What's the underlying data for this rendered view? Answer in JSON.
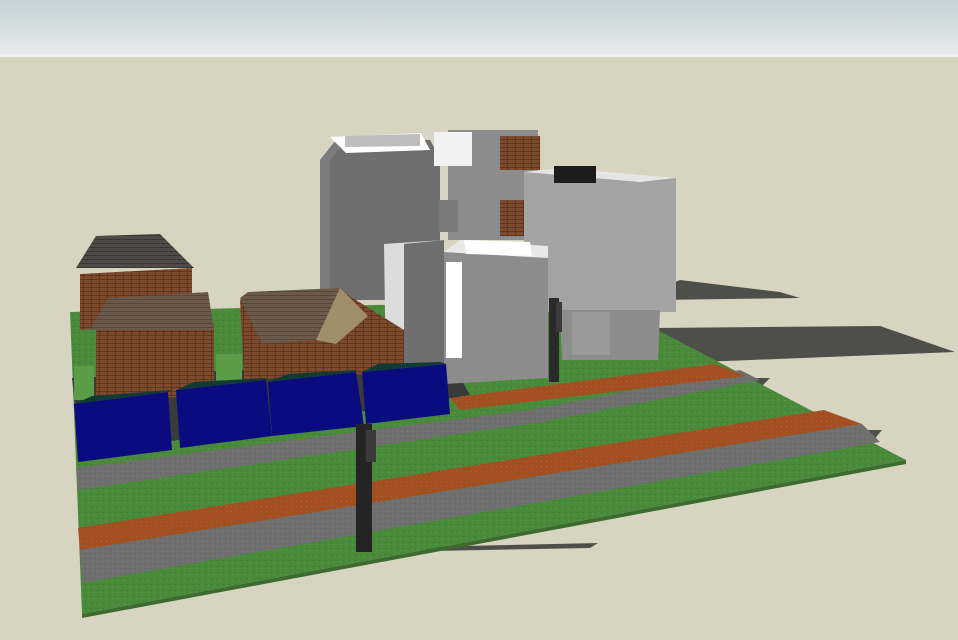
{
  "viewport": {
    "sky_color": "#d2dde1",
    "ground_color": "#d8d4c2",
    "grass_color": "#4d8a3a",
    "road_color": "#6e6e6e",
    "path_color": "#a04f24",
    "building_gray": "#8a8a8a",
    "roof_brown": "#5a4634",
    "brick_color": "#7a4a30",
    "container_blue": "#0d0d7a",
    "shadow_color": "#4a4a44"
  },
  "scene": {
    "objects": [
      "terrain-slab",
      "road-near",
      "bike-path-near",
      "road-far",
      "bike-path-far",
      "tower-block-left",
      "tower-block-back",
      "office-block-right",
      "office-block-front",
      "brick-house-back",
      "brick-house-mid",
      "brick-house-front",
      "blue-container-row",
      "street-pole-near",
      "street-pole-far"
    ]
  }
}
